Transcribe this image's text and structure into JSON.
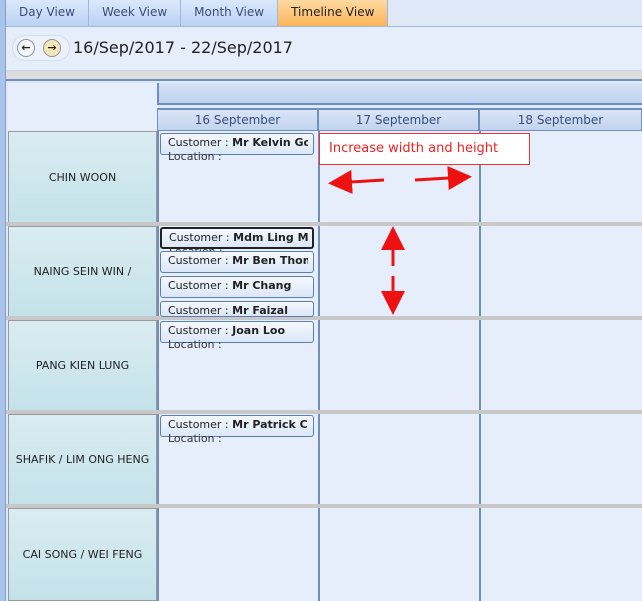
{
  "tabs": [
    {
      "label": "Day View"
    },
    {
      "label": "Week View"
    },
    {
      "label": "Month View"
    },
    {
      "label": "Timeline View",
      "active": true
    }
  ],
  "toolbar": {
    "date_range": "16/Sep/2017 - 22/Sep/2017",
    "prev_icon": "arrow-left-icon",
    "next_icon": "arrow-right-icon"
  },
  "columns": [
    "16 September",
    "17 September",
    "18 September"
  ],
  "resources": [
    "CHIN WOON",
    "NAING SEIN WIN /",
    "PANG KIEN LUNG",
    "SHAFIK / LIM ONG HENG",
    "CAI SONG / WEI FENG"
  ],
  "appointments": [
    {
      "prefix": "Customer : ",
      "name": "Mr Kelvin Goh",
      "location": "Location :"
    },
    {
      "prefix": "Customer : ",
      "name": "Mdm Ling Mee K",
      "location": "Location :"
    },
    {
      "prefix": "Customer : ",
      "name": "Mr Ben Thompso",
      "location": ""
    },
    {
      "prefix": "Customer : ",
      "name": "Mr Chang",
      "location": ""
    },
    {
      "prefix": "Customer : ",
      "name": "Mr Faizal",
      "location": ""
    },
    {
      "prefix": "Customer : ",
      "name": "Joan Loo",
      "location": "Location :"
    },
    {
      "prefix": "Customer : ",
      "name": "Mr Patrick Chan",
      "location": "Location :"
    }
  ],
  "annotation": {
    "text": "Increase width and height",
    "color": "#ee2222"
  },
  "colors": {
    "active_tab": "#fbb55a",
    "grid_border": "#6f8fbf"
  }
}
